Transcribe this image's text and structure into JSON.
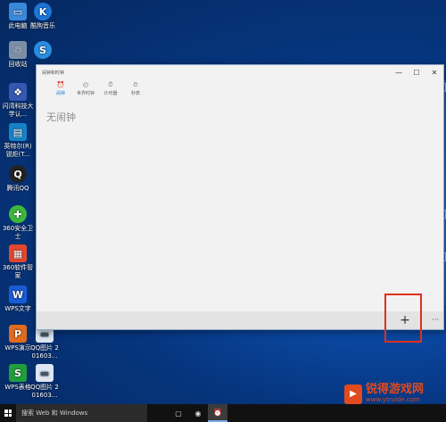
{
  "desktop": {
    "icons": [
      {
        "label": "此电脑",
        "icon": "computer-icon",
        "color": "#3a88d8",
        "glyph": "▭"
      },
      {
        "label": "酷狗音乐",
        "icon": "kugou-icon",
        "color": "#1d75d8",
        "glyph": "K"
      },
      {
        "label": "回收站",
        "icon": "recycle-bin-icon",
        "color": "#7c8fa6",
        "glyph": "♲"
      },
      {
        "label": "",
        "icon": "sogou-icon",
        "color": "#2a8ce0",
        "glyph": "S"
      },
      {
        "label": "闪湾科技大学认...",
        "icon": "school-icon",
        "color": "#3558b0",
        "glyph": "❖"
      },
      {
        "label": "英特尔(R) 锐炬(T...",
        "icon": "intel-icon",
        "color": "#1483c8",
        "glyph": "▤"
      },
      {
        "label": "腾讯QQ",
        "icon": "qq-icon",
        "color": "#222222",
        "glyph": "Q"
      },
      {
        "label": "360安全卫士",
        "icon": "360-safe-icon",
        "color": "#3db83d",
        "glyph": "✚"
      },
      {
        "label": "360软件管家",
        "icon": "360-software-icon",
        "color": "#e4462e",
        "glyph": "▦"
      },
      {
        "label": "WPS文字",
        "icon": "wps-writer-icon",
        "color": "#1a5bd6",
        "glyph": "W"
      },
      {
        "label": "WPS演示",
        "icon": "wps-presentation-icon",
        "color": "#e06a1e",
        "glyph": "P"
      },
      {
        "label": "QQ图片 201603...",
        "icon": "image-file-icon",
        "color": "#dde6f2",
        "glyph": "▬"
      },
      {
        "label": "WPS表格",
        "icon": "wps-spreadsheet-icon",
        "color": "#1f9e3b",
        "glyph": "S"
      },
      {
        "label": "QQ图片 201603...",
        "icon": "image-file-icon",
        "color": "#dde6f2",
        "glyph": "▬"
      }
    ]
  },
  "window": {
    "title": "闹钟和时钟",
    "controls": {
      "minimize": "—",
      "maximize": "☐",
      "close": "✕"
    },
    "tabs": [
      {
        "label": "闹钟",
        "icon": "alarm-icon",
        "glyph": "⏰",
        "active": true
      },
      {
        "label": "世界时钟",
        "icon": "world-clock-icon",
        "glyph": "◴",
        "active": false
      },
      {
        "label": "计时器",
        "icon": "timer-icon",
        "glyph": "⏱",
        "active": false
      },
      {
        "label": "秒表",
        "icon": "stopwatch-icon",
        "glyph": "⏲",
        "active": false
      }
    ],
    "empty_message": "无闹钟",
    "appbar": {
      "add": "+",
      "more": "···"
    }
  },
  "taskbar": {
    "search_placeholder": "搜索 Web 和 Windows",
    "items": [
      {
        "icon": "task-view-icon",
        "glyph": "▢",
        "active": false
      },
      {
        "icon": "browser-icon",
        "glyph": "◉",
        "active": false
      },
      {
        "icon": "alarm-app-icon",
        "glyph": "⏰",
        "active": true
      }
    ]
  },
  "watermark": {
    "title": "锐得游戏网",
    "url": "www.ytruide.com",
    "logo_glyph": "▶"
  }
}
